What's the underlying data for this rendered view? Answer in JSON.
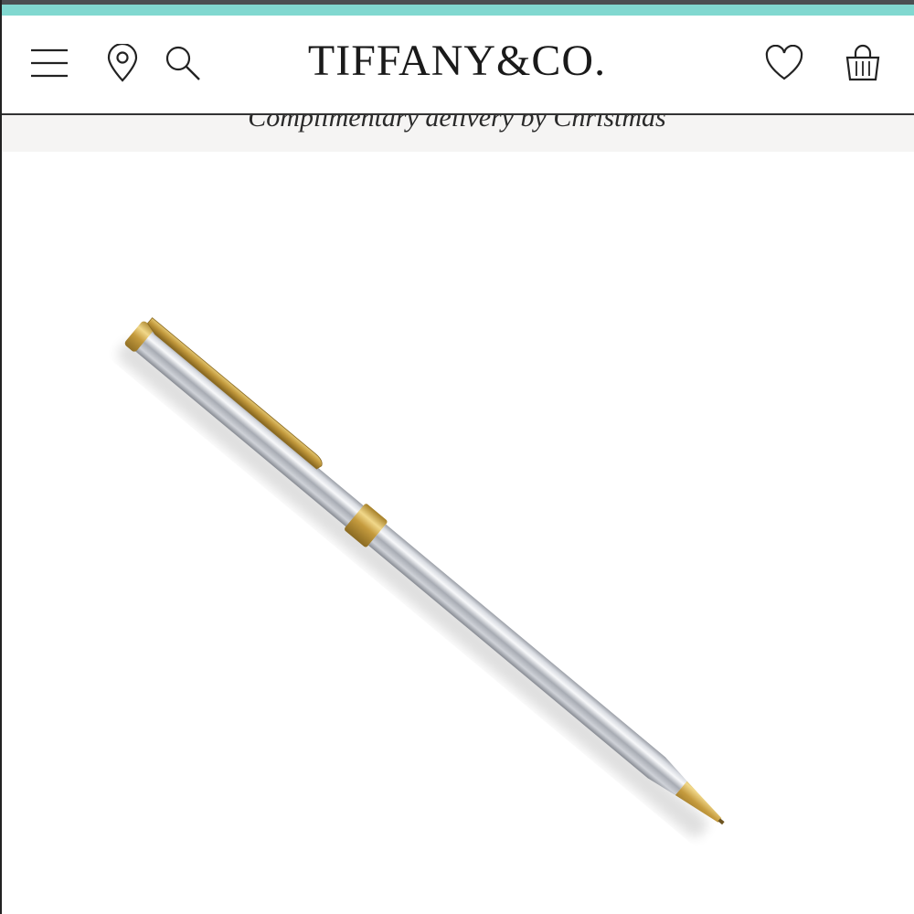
{
  "brand": {
    "logo_text": "TIFFANY&CO."
  },
  "header": {
    "menu_icon": "hamburger-menu-icon",
    "location_icon": "map-pin-icon",
    "search_icon": "search-icon",
    "wishlist_icon": "heart-icon",
    "bag_icon": "shopping-bag-icon"
  },
  "banner": {
    "text": "Complimentary delivery by Christmas"
  },
  "product": {
    "image_subject": "ballpoint-pen-image"
  },
  "colors": {
    "accent_teal": "#81d8d0",
    "header_border": "#333333",
    "banner_bg": "#f5f4f3",
    "gold": "#d4b25a",
    "silver": "#c9ccd3"
  }
}
